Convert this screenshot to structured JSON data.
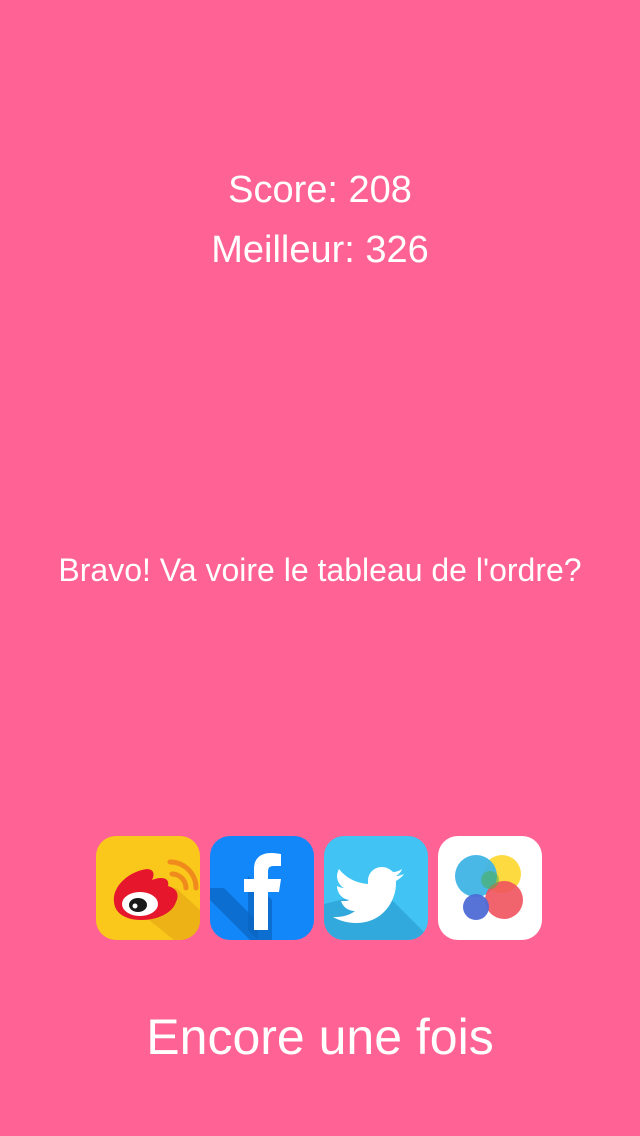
{
  "result": {
    "score_text": "Score: 208",
    "best_text": "Meilleur: 326",
    "message": "Bravo! Va voire le tableau de l'ordre?"
  },
  "share": {
    "buttons": [
      {
        "service": "weibo",
        "icon": "weibo-icon",
        "color": "#f9c81b"
      },
      {
        "service": "facebook",
        "icon": "facebook-icon",
        "color": "#1287f9"
      },
      {
        "service": "twitter",
        "icon": "twitter-icon",
        "color": "#41c4f4"
      },
      {
        "service": "game-center",
        "icon": "game-center-icon",
        "color": "#ffffff"
      }
    ]
  },
  "actions": {
    "retry_label": "Encore une fois"
  },
  "theme": {
    "background": "#ff6294",
    "text": "#ffffff"
  }
}
